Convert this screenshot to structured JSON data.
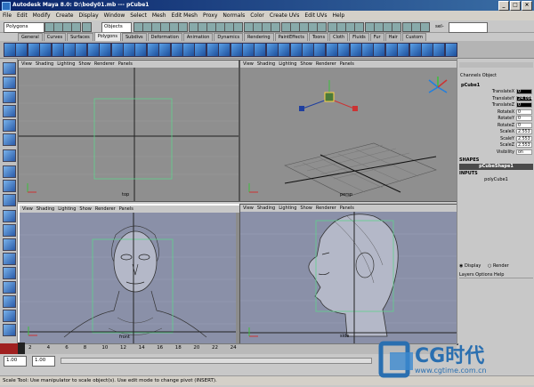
{
  "window": {
    "title": "Autodesk Maya 8.0: D:\\body01.mb   ---   pCube1",
    "minimize": "_",
    "maximize": "□",
    "close": "×"
  },
  "menubar": [
    "File",
    "Edit",
    "Modify",
    "Create",
    "Display",
    "Window",
    "Select",
    "Mesh",
    "Edit Mesh",
    "Proxy",
    "Normals",
    "Color",
    "Create UVs",
    "Edit UVs",
    "Help"
  ],
  "statusline": {
    "mode": "Polygons",
    "selection_mask": "Objects",
    "sel_label": "sel-",
    "sel_value": ""
  },
  "shelf_tabs": [
    "General",
    "Curves",
    "Surfaces",
    "Polygons",
    "Subdivs",
    "Deformation",
    "Animation",
    "Dynamics",
    "Rendering",
    "PaintEffects",
    "Toons",
    "Cloth",
    "Fluids",
    "Fur",
    "Hair",
    "Custom"
  ],
  "shelf_active": "Polygons",
  "viewports": [
    {
      "id": "top",
      "menu": [
        "View",
        "Shading",
        "Lighting",
        "Show",
        "Renderer",
        "Panels"
      ],
      "label": "top"
    },
    {
      "id": "persp",
      "menu": [
        "View",
        "Shading",
        "Lighting",
        "Show",
        "Renderer",
        "Panels"
      ],
      "label": "persp"
    },
    {
      "id": "front",
      "menu": [
        "View",
        "Shading",
        "Lighting",
        "Show",
        "Renderer",
        "Panels"
      ],
      "label": "front"
    },
    {
      "id": "side",
      "menu": [
        "View",
        "Shading",
        "Lighting",
        "Show",
        "Renderer",
        "Panels"
      ],
      "label": "side"
    }
  ],
  "channel_box": {
    "header": [
      "Channels",
      "Object"
    ],
    "object": "pCube1",
    "attributes": [
      {
        "name": "TranslateX",
        "value": "0",
        "hl": true
      },
      {
        "name": "TranslateY",
        "value": "24.094",
        "hl": true
      },
      {
        "name": "TranslateZ",
        "value": "0",
        "hl": true
      },
      {
        "name": "RotateX",
        "value": "0",
        "hl": false
      },
      {
        "name": "RotateY",
        "value": "0",
        "hl": false
      },
      {
        "name": "RotateZ",
        "value": "0",
        "hl": false
      },
      {
        "name": "ScaleX",
        "value": "2.553",
        "hl": false
      },
      {
        "name": "ScaleY",
        "value": "2.553",
        "hl": false
      },
      {
        "name": "ScaleZ",
        "value": "2.553",
        "hl": false
      },
      {
        "name": "Visibility",
        "value": "on",
        "hl": false
      }
    ],
    "shapes_title": "SHAPES",
    "shape": "pCubeShape1",
    "inputs_title": "INPUTS",
    "input": "polyCube1",
    "display_label": "Display",
    "render_label": "Render",
    "layer_menu": [
      "Layers",
      "Options",
      "Help"
    ]
  },
  "timeline": {
    "ticks": [
      "2",
      "4",
      "6",
      "8",
      "10",
      "12",
      "14",
      "16",
      "18",
      "20",
      "22",
      "24"
    ],
    "current": "1"
  },
  "range": {
    "start": "1.00",
    "start2": "1.00"
  },
  "help_line": "Scale Tool: Use manipulator to scale object(s). Use edit mode to change pivot (INSERT).",
  "watermark": {
    "brand": "CG时代",
    "url": "www.cgtime.com.cn"
  },
  "colors": {
    "title_blue": "#0a246a",
    "viewport_bg": "#8c8c8c",
    "grid_green": "#5fd38d",
    "selected_blue": "#1f3f9f"
  }
}
